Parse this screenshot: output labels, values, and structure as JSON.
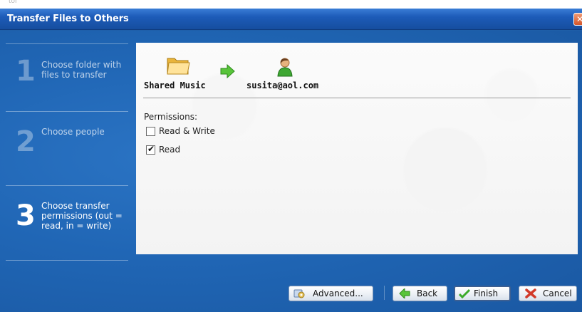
{
  "window": {
    "title": "Transfer Files to Others",
    "close_label": "✕"
  },
  "ghost_text": "tor",
  "steps": [
    {
      "number": "1",
      "label": "Choose folder with files to transfer",
      "active": false
    },
    {
      "number": "2",
      "label": "Choose people",
      "active": false
    },
    {
      "number": "3",
      "label": "Choose transfer permissions (out = read, in = write)",
      "active": true
    }
  ],
  "transfer": {
    "source": "Shared Music",
    "destination": "susita@aol.com",
    "source_icon": "folder-icon",
    "arrow_icon": "arrow-right-icon",
    "destination_icon": "person-icon"
  },
  "permissions": {
    "title": "Permissions:",
    "options": [
      {
        "label": "Read & Write",
        "checked": false
      },
      {
        "label": "Read",
        "checked": true
      }
    ]
  },
  "buttons": {
    "advanced": "Advanced...",
    "back": "Back",
    "finish": "Finish",
    "cancel": "Cancel"
  },
  "colors": {
    "title_bar": "#1d5bb8",
    "window_bg": "#2066b5",
    "accent_green": "#4caf2f",
    "cancel_red": "#d23a2a"
  }
}
